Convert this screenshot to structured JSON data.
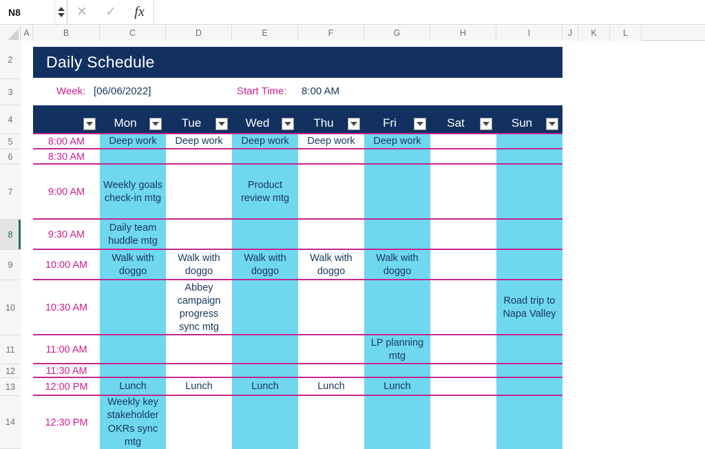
{
  "formula_bar": {
    "name_box": "N8",
    "cancel_icon": "close-icon",
    "accept_icon": "check-icon",
    "function_icon": "fx-icon",
    "formula_value": ""
  },
  "grid": {
    "columns": [
      "A",
      "B",
      "C",
      "D",
      "E",
      "F",
      "G",
      "H",
      "I",
      "J",
      "K",
      "L"
    ],
    "rows": [
      "2",
      "3",
      "4",
      "5",
      "6",
      "7",
      "8",
      "9",
      "10",
      "11",
      "12",
      "13",
      "14"
    ],
    "selected_row": "8"
  },
  "sheet": {
    "title": "Daily Schedule",
    "week_label": "Week:",
    "week_value": "[06/06/2022]",
    "start_time_label": "Start Time:",
    "start_time_value": "8:00 AM",
    "days": [
      "Mon",
      "Tue",
      "Wed",
      "Thu",
      "Fri",
      "Sat",
      "Sun"
    ],
    "times": [
      "8:00 AM",
      "8:30 AM",
      "9:00 AM",
      "9:30 AM",
      "10:00 AM",
      "10:30 AM",
      "11:00 AM",
      "11:30 AM",
      "12:00 PM",
      "12:30 PM"
    ],
    "entries": [
      [
        "Deep work",
        "Deep work",
        "Deep work",
        "Deep work",
        "Deep work",
        "",
        ""
      ],
      [
        "",
        "",
        "",
        "",
        "",
        "",
        ""
      ],
      [
        "Weekly goals check-in mtg",
        "",
        "Product review mtg",
        "",
        "",
        "",
        ""
      ],
      [
        "Daily team huddle mtg",
        "",
        "",
        "",
        "",
        "",
        ""
      ],
      [
        "Walk with doggo",
        "Walk with doggo",
        "Walk with doggo",
        "Walk with doggo",
        "Walk with doggo",
        "",
        ""
      ],
      [
        "",
        "Abbey campaign progress sync mtg",
        "",
        "",
        "",
        "",
        "Road trip to Napa Valley"
      ],
      [
        "",
        "",
        "",
        "",
        "LP planning mtg",
        "",
        ""
      ],
      [
        "",
        "",
        "",
        "",
        "",
        "",
        ""
      ],
      [
        "Lunch",
        "Lunch",
        "Lunch",
        "Lunch",
        "Lunch",
        "",
        ""
      ],
      [
        "Weekly key stakeholder OKRs sync mtg",
        "",
        "",
        "",
        "",
        "",
        ""
      ]
    ],
    "colors": {
      "banner": "#123160",
      "band": "#6FD8EE",
      "separator": "#C2268F",
      "accent_text": "#CE1F8E",
      "entry_text": "#17365d"
    }
  }
}
